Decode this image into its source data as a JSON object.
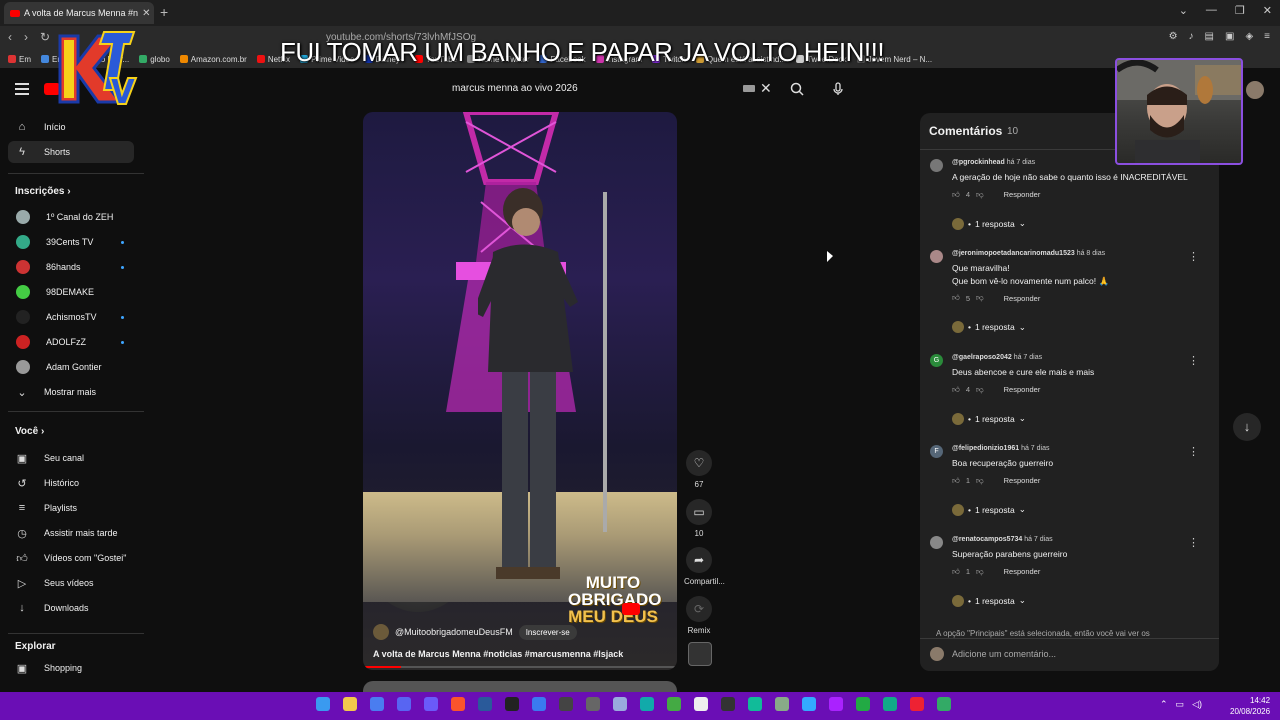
{
  "browser": {
    "tab_title": "A volta de Marcus Menna #n",
    "url": "youtube.com/shorts/73lvhMfJSOg",
    "bookmarks": [
      "Em",
      "Email – Thiago Urur...",
      "globo",
      "Amazon.com.br",
      "Netflix",
      "Prime Video",
      "Disney+",
      "YouTube",
      "Home / Twitter",
      "Facebook",
      "Instagram",
      "Twitch",
      "Quem está assistind...",
      "TweetDeck",
      "Jovem Nerd – N..."
    ]
  },
  "overlay": {
    "message": "FUI TOMAR UM BANHO E PAPAR JA VOLTO HEIN!!!"
  },
  "search": {
    "value": "marcus menna ao vivo 2026"
  },
  "sidebar": {
    "main": [
      {
        "label": "Início",
        "icon": "home-icon"
      },
      {
        "label": "Shorts",
        "icon": "shorts-icon"
      }
    ],
    "subs_heading": "Inscrições",
    "channels": [
      {
        "label": "1º Canal do ZEH",
        "color": "#9aa",
        "dot": false
      },
      {
        "label": "39Cents TV",
        "color": "#3a8",
        "dot": true
      },
      {
        "label": "86hands",
        "color": "#c33",
        "dot": true
      },
      {
        "label": "98DEMAKE",
        "color": "#4c4",
        "dot": false
      },
      {
        "label": "AchismosTV",
        "color": "#222",
        "dot": true
      },
      {
        "label": "ADOLFzZ",
        "color": "#c22",
        "dot": true
      },
      {
        "label": "Adam Gontier",
        "color": "#999",
        "dot": false
      }
    ],
    "show_more": "Mostrar mais",
    "you_heading": "Você",
    "you_items": [
      {
        "label": "Seu canal",
        "icon": "channel-icon"
      },
      {
        "label": "Histórico",
        "icon": "history-icon"
      },
      {
        "label": "Playlists",
        "icon": "playlists-icon"
      },
      {
        "label": "Assistir mais tarde",
        "icon": "watch-later-icon"
      },
      {
        "label": "Vídeos com \"Gostei\"",
        "icon": "like-icon"
      },
      {
        "label": "Seus vídeos",
        "icon": "your-videos-icon"
      },
      {
        "label": "Downloads",
        "icon": "download-icon"
      }
    ],
    "explore_heading": "Explorar",
    "explore_items": [
      {
        "label": "Shopping",
        "icon": "shopping-icon"
      }
    ]
  },
  "video": {
    "channel": "@MuitoobrigadomeuDeusFM",
    "subscribe_label": "Inscrever-se",
    "title": "A volta de Marcus Menna #noticias #marcusmenna #lsjack",
    "watermark_l1": "MUITO",
    "watermark_l2": "OBRIGADO",
    "watermark_l3": "MEU DEUS",
    "progress": 0.12
  },
  "actions": {
    "likes": "67",
    "comments": "10",
    "share": "Compartil...",
    "remix": "Remix"
  },
  "comments": {
    "title": "Comentários",
    "count": "10",
    "items": [
      {
        "author": "@pgrockinhead",
        "time": "há 7 dias",
        "lines": [
          "A geração de hoje não sabe o quanto isso é INACREDITÁVEL"
        ],
        "likes": "4",
        "replies": "1 resposta",
        "av": "#777"
      },
      {
        "author": "@jeronimopoetadancarinomadu1523",
        "time": "há 8 dias",
        "lines": [
          "Que maravilha!",
          "Que bom vê-lo novamente num palco! 🙏"
        ],
        "likes": "5",
        "replies": "1 resposta",
        "av": "#a88"
      },
      {
        "author": "@gaelraposo2042",
        "time": "há 7 dias",
        "lines": [
          "Deus abencoe e cure ele mais e mais"
        ],
        "likes": "4",
        "replies": "1 resposta",
        "av": "#2a8a3a",
        "initial": "G"
      },
      {
        "author": "@felipedionizio1961",
        "time": "há 7 dias",
        "lines": [
          "Boa recuperação guerreiro"
        ],
        "likes": "1",
        "replies": "1 resposta",
        "av": "#556677",
        "initial": "F"
      },
      {
        "author": "@renatocampos5734",
        "time": "há 7 dias",
        "lines": [
          "Superação parabens guerreiro"
        ],
        "likes": "1",
        "replies": "1 resposta",
        "av": "#888"
      }
    ],
    "reply_label": "Responder",
    "hint": "A opção \"Principais\" está selecionada, então você vai ver os",
    "add_placeholder": "Adicione um comentário..."
  },
  "taskbar": {
    "time": "14:42",
    "date": "20/08/2026"
  }
}
